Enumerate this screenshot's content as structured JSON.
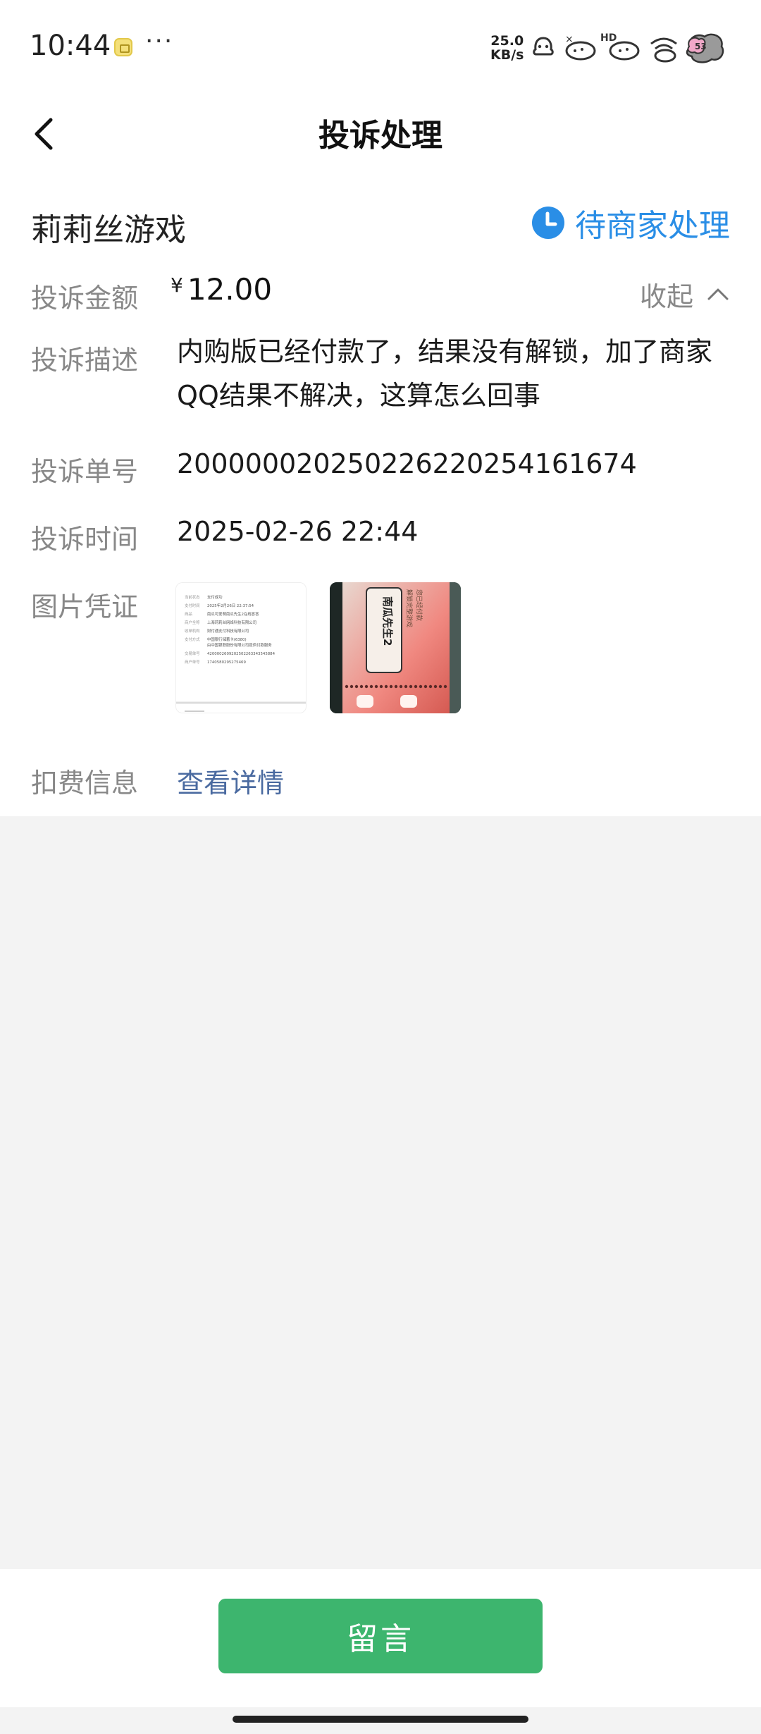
{
  "status_bar": {
    "time": "10:44",
    "more": "···",
    "net_speed_value": "25.0",
    "net_speed_unit": "KB/s",
    "hd_label": "HD",
    "icons": [
      "notification-icon",
      "alarm-icon",
      "signal-icon",
      "hd-signal-icon",
      "wifi-icon",
      "battery-icon"
    ]
  },
  "header": {
    "title": "投诉处理",
    "back_icon": "chevron-left-icon"
  },
  "complaint": {
    "merchant": "莉莉丝游戏",
    "status": "待商家处理",
    "status_icon": "clock-icon",
    "status_color": "#2a8ee6",
    "amount_label": "投诉金额",
    "amount_currency": "¥",
    "amount": "12.00",
    "collapse_label": "收起",
    "description_label": "投诉描述",
    "description": "内购版已经付款了，结果没有解锁，加了商家QQ结果不解决，这算怎么回事",
    "order_label": "投诉单号",
    "order_no": "200000020250226220254161674",
    "time_label": "投诉时间",
    "time": "2025-02-26 22:44",
    "evidence_label": "图片凭证",
    "fee_label": "扣费信息",
    "fee_link": "查看详情"
  },
  "receipt_thumb": {
    "rows": [
      {
        "k": "当前状态",
        "v": "支付成功"
      },
      {
        "k": "支付时间",
        "v": "2025年2月26日 22:37:54"
      },
      {
        "k": "商品",
        "v": "南瓜可爱萌南瓜先生2在线答答"
      },
      {
        "k": "商户全称",
        "v": "上海莉莉丝网络科技有限公司"
      },
      {
        "k": "收单机构",
        "v": "财付通支付科技有限公司"
      },
      {
        "k": "支付方式",
        "v": "中国银行储蓄卡(6380)"
      },
      {
        "k": "",
        "v": "由中国银联股份有限公司提供付款服务"
      },
      {
        "k": "交易单号",
        "v": "4200002609202502263343545884"
      },
      {
        "k": "商户单号",
        "v": "1740580295275469"
      }
    ]
  },
  "photo_thumb": {
    "text_main": "南瓜先生2",
    "text_side": "解锁完整游戏",
    "text_side2": "您已经付款"
  },
  "bottom": {
    "message_button": "留言",
    "button_color": "#3db56e"
  }
}
